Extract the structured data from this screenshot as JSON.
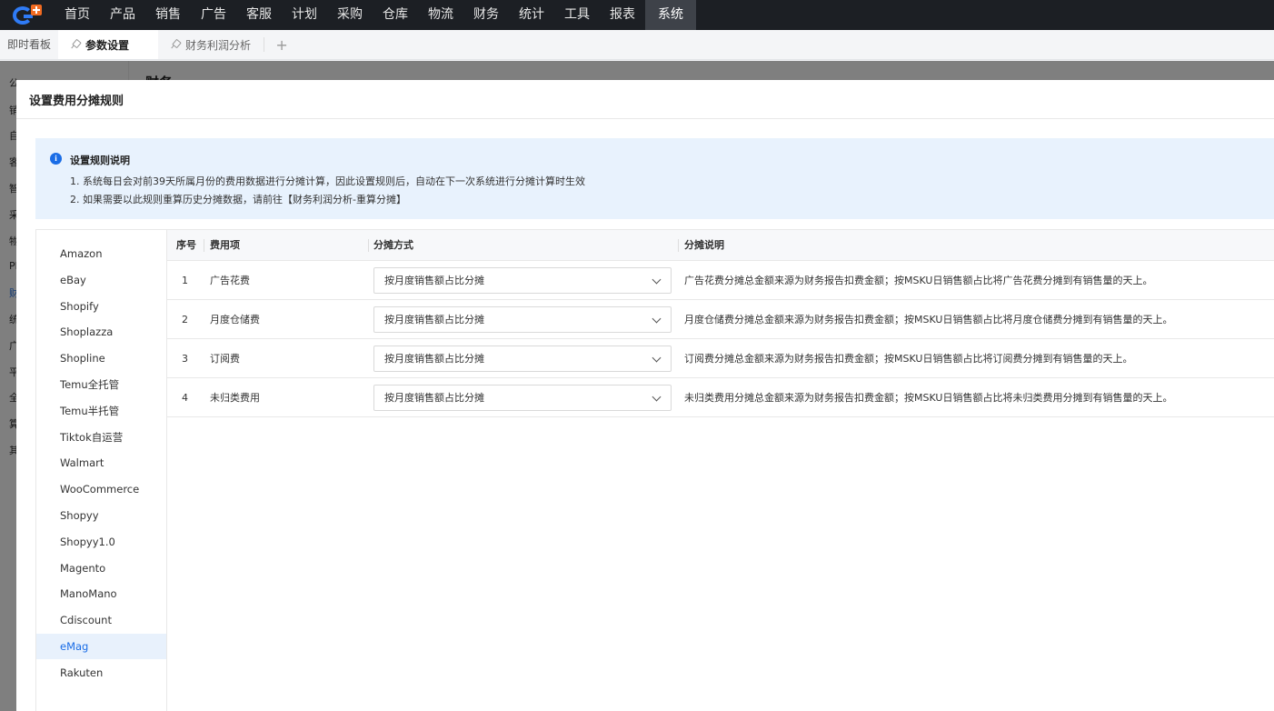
{
  "topnav": {
    "items": [
      "首页",
      "产品",
      "销售",
      "广告",
      "客服",
      "计划",
      "采购",
      "仓库",
      "物流",
      "财务",
      "统计",
      "工具",
      "报表",
      "系统"
    ],
    "active": "系统"
  },
  "tabbar": {
    "dashboard": "即时看板",
    "tabs": [
      {
        "label": "参数设置",
        "active": true
      },
      {
        "label": "财务利润分析",
        "active": false
      }
    ],
    "add": "+"
  },
  "background": {
    "title": "财务",
    "sidebar_chars": [
      "公",
      "销",
      "自",
      "客",
      "智",
      "采",
      "物",
      "Pl",
      "财",
      "统",
      "广",
      "平",
      "全",
      "算",
      "其"
    ]
  },
  "modal": {
    "title": "设置费用分摊规则",
    "notice": {
      "icon": "i",
      "title": "设置规则说明",
      "lines": [
        "1. 系统每日会对前39天所属月份的费用数据进行分摊计算，因此设置规则后，自动在下一次系统进行分摊计算时生效",
        "2. 如果需要以此规则重算历史分摊数据，请前往【财务利润分析-重算分摊】"
      ]
    },
    "platforms": [
      "Amazon",
      "eBay",
      "Shopify",
      "Shoplazza",
      "Shopline",
      "Temu全托管",
      "Temu半托管",
      "Tiktok自运营",
      "Walmart",
      "WooCommerce",
      "Shopyy",
      "Shopyy1.0",
      "Magento",
      "ManoMano",
      "Cdiscount",
      "eMag",
      "Rakuten"
    ],
    "active_platform": "eMag",
    "table": {
      "headers": {
        "index": "序号",
        "item": "费用项",
        "method": "分摊方式",
        "desc": "分摊说明"
      },
      "rows": [
        {
          "index": "1",
          "item": "广告花费",
          "method": "按月度销售额占比分摊",
          "desc": "广告花费分摊总金额来源为财务报告扣费金额；按MSKU日销售额占比将广告花费分摊到有销售量的天上。"
        },
        {
          "index": "2",
          "item": "月度仓储费",
          "method": "按月度销售额占比分摊",
          "desc": "月度仓储费分摊总金额来源为财务报告扣费金额；按MSKU日销售额占比将月度仓储费分摊到有销售量的天上。"
        },
        {
          "index": "3",
          "item": "订阅费",
          "method": "按月度销售额占比分摊",
          "desc": "订阅费分摊总金额来源为财务报告扣费金额；按MSKU日销售额占比将订阅费分摊到有销售量的天上。"
        },
        {
          "index": "4",
          "item": "未归类费用",
          "method": "按月度销售额占比分摊",
          "desc": "未归类费用分摊总金额来源为财务报告扣费金额；按MSKU日销售额占比将未归类费用分摊到有销售量的天上。"
        }
      ]
    }
  }
}
